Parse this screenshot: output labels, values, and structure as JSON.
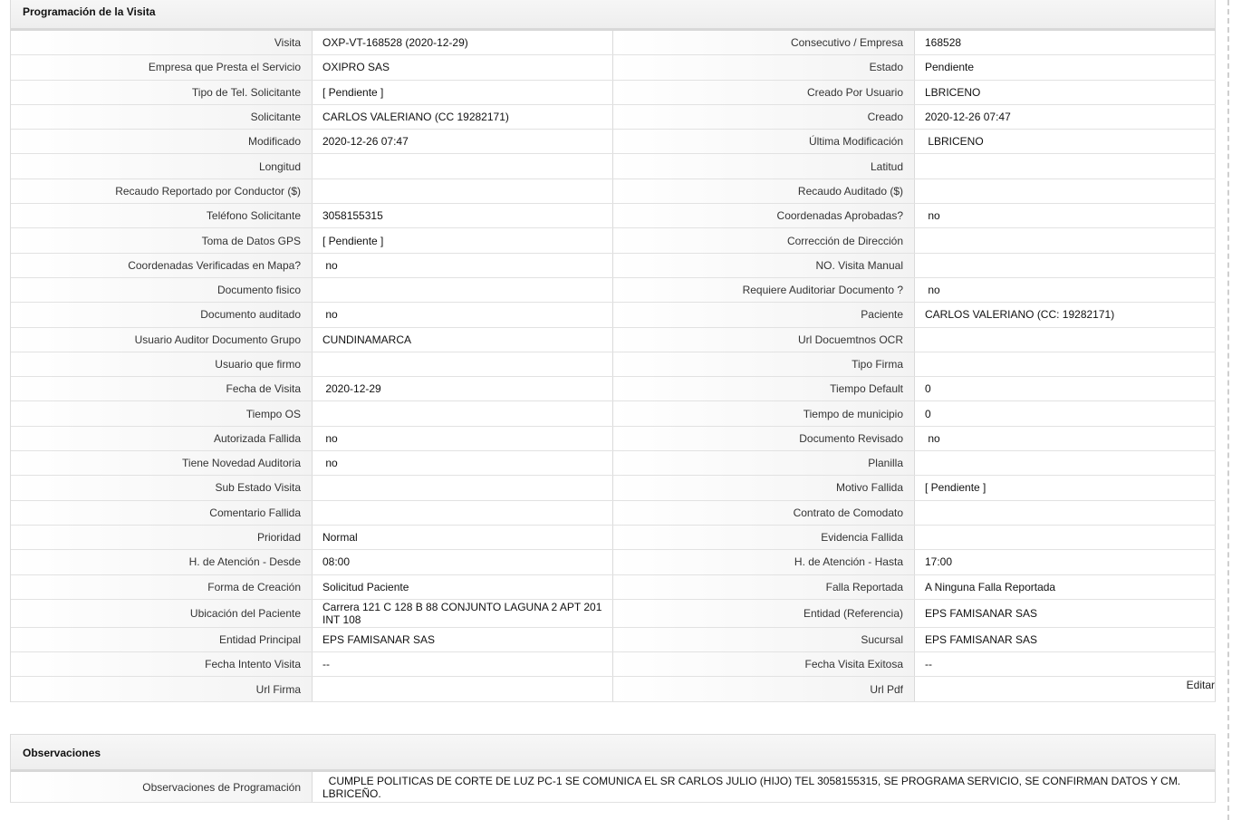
{
  "visit_section": {
    "title": "Programación de la Visita",
    "edit_label": "Editar",
    "rows": [
      {
        "l1": "Visita",
        "v1": "OXP-VT-168528 (2020-12-29)",
        "l2": "Consecutivo / Empresa",
        "v2": "168528"
      },
      {
        "l1": "Empresa que Presta el Servicio",
        "v1": "OXIPRO SAS",
        "l2": "Estado",
        "v2": "Pendiente"
      },
      {
        "l1": "Tipo de Tel. Solicitante",
        "v1": "[ Pendiente ]",
        "l2": "Creado Por Usuario",
        "v2": "LBRICENO"
      },
      {
        "l1": "Solicitante",
        "v1": "CARLOS VALERIANO (CC 19282171)",
        "l2": "Creado",
        "v2": "2020-12-26 07:47"
      },
      {
        "l1": "Modificado",
        "v1": "2020-12-26 07:47",
        "l2": "Última Modificación",
        "v2": " LBRICENO"
      },
      {
        "l1": "Longitud",
        "v1": "",
        "l2": "Latitud",
        "v2": ""
      },
      {
        "l1": "Recaudo Reportado por Conductor ($)",
        "v1": "",
        "l2": "Recaudo Auditado ($)",
        "v2": ""
      },
      {
        "l1": "Teléfono Solicitante",
        "v1": "3058155315",
        "l2": "Coordenadas Aprobadas?",
        "v2": " no"
      },
      {
        "l1": "Toma de Datos GPS",
        "v1": "[ Pendiente ]",
        "l2": "Corrección de Dirección",
        "v2": ""
      },
      {
        "l1": "Coordenadas Verificadas en Mapa?",
        "v1": " no",
        "l2": "NO. Visita Manual",
        "v2": ""
      },
      {
        "l1": "Documento fisico",
        "v1": "",
        "l2": "Requiere Auditoriar Documento ?",
        "v2": " no"
      },
      {
        "l1": "Documento auditado",
        "v1": " no",
        "l2": "Paciente",
        "v2": "CARLOS VALERIANO (CC: 19282171)"
      },
      {
        "l1": "Usuario Auditor Documento Grupo",
        "v1": "CUNDINAMARCA",
        "l2": "Url Docuemtnos OCR",
        "v2": ""
      },
      {
        "l1": "Usuario que firmo",
        "v1": "",
        "l2": "Tipo Firma",
        "v2": ""
      },
      {
        "l1": "Fecha de Visita",
        "v1": " 2020-12-29",
        "l2": "Tiempo Default",
        "v2": "0"
      },
      {
        "l1": "Tiempo OS",
        "v1": "",
        "l2": "Tiempo de municipio",
        "v2": "0"
      },
      {
        "l1": "Autorizada Fallida",
        "v1": " no",
        "l2": "Documento Revisado",
        "v2": " no"
      },
      {
        "l1": "Tiene Novedad Auditoria",
        "v1": " no",
        "l2": "Planilla",
        "v2": ""
      },
      {
        "l1": "Sub Estado Visita",
        "v1": "",
        "l2": "Motivo Fallida",
        "v2": "[ Pendiente ]"
      },
      {
        "l1": "Comentario Fallida",
        "v1": "",
        "l2": "Contrato de Comodato",
        "v2": ""
      },
      {
        "l1": "Prioridad",
        "v1": "Normal",
        "l2": "Evidencia Fallida",
        "v2": ""
      },
      {
        "l1": "H. de Atención - Desde",
        "v1": "08:00",
        "l2": "H. de Atención - Hasta",
        "v2": "17:00"
      },
      {
        "l1": "Forma de Creación",
        "v1": "Solicitud Paciente",
        "l2": "Falla Reportada",
        "v2": "A Ninguna Falla Reportada"
      },
      {
        "l1": "Ubicación del Paciente",
        "v1": "Carrera 121 C 128 B 88 CONJUNTO LAGUNA 2 APT 201 INT 108",
        "l2": "Entidad (Referencia)",
        "v2": "EPS FAMISANAR SAS"
      },
      {
        "l1": "Entidad Principal",
        "v1": "EPS FAMISANAR SAS",
        "l2": "Sucursal",
        "v2": "EPS FAMISANAR SAS"
      },
      {
        "l1": "Fecha Intento Visita",
        "v1": "--",
        "l2": "Fecha Visita Exitosa",
        "v2": "--"
      },
      {
        "l1": "Url Firma",
        "v1": "",
        "l2": "Url Pdf",
        "v2": ""
      }
    ]
  },
  "observations_section": {
    "title": "Observaciones",
    "label": "Observaciones de Programación",
    "value": "  CUMPLE POLITICAS DE CORTE DE LUZ PC-1 SE COMUNICA EL SR CARLOS JULIO (HIJO) TEL 3058155315, SE PROGRAMA SERVICIO, SE CONFIRMAN DATOS Y CM. LBRICEÑO."
  }
}
